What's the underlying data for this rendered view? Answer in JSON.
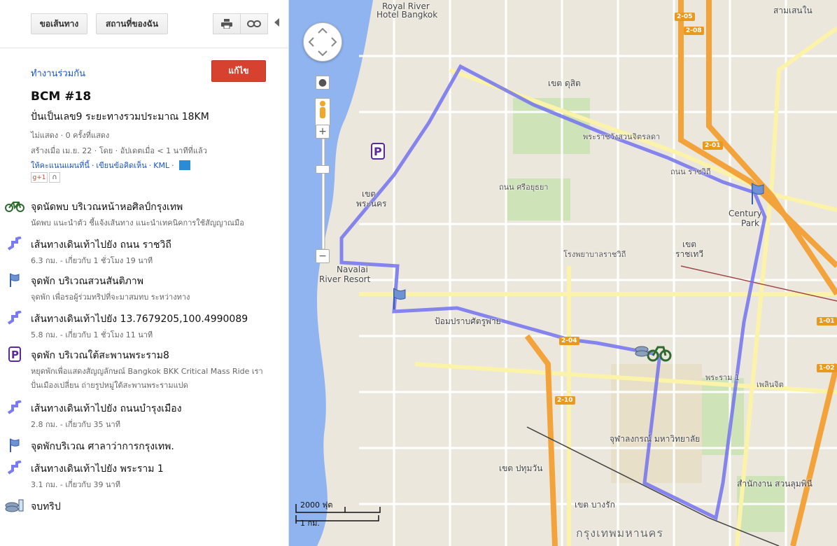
{
  "toolbar": {
    "directions": "ขอเส้นทาง",
    "my_places": "สถานที่ของฉัน"
  },
  "map_info": {
    "collaborate": "ทำงานร่วมกัน",
    "edit": "แก้ไข",
    "title": "BCM #18",
    "description": "ปั่นเป็นเลข9 ระยะทางรวมประมาณ 18KM",
    "views": "ไม่แสดง · 0 ครั้งที่แสดง",
    "created": "สร้างเมื่อ เม.ย. 22 · โดย  · อัปเดตเมื่อ < 1 นาทีที่แล้ว",
    "rate": "ให้คะแนนแผนที่นี้",
    "comment": "เขียนข้อคิดเห็น",
    "kml": "KML",
    "gplus": "g+1"
  },
  "items": [
    {
      "icon": "bicycle-icon",
      "title": "จุดนัดพบ บริเวณหน้าหอศิลป์กรุงเทพ",
      "sub": "นัดพบ แนะนำตัว ชี้แจ้งเส้นทาง แนะนำเทคนิคการใช้สัญญาณมือ",
      "sub2": ""
    },
    {
      "icon": "route-icon",
      "title": "เส้นทางเดินเท้าไปยัง ถนน ราชวิถี",
      "sub": "6.3 กม. - เกี่ยวกับ 1 ชั่วโมง 19 นาที",
      "sub2": ""
    },
    {
      "icon": "flag-icon",
      "title": "จุดพัก บริเวณสวนสันติภาพ",
      "sub": "จุดพัก เพื่อรอผู้ร่วมทริปที่จะมาสมทบ ระหว่างทาง",
      "sub2": ""
    },
    {
      "icon": "route-icon",
      "title": "เส้นทางเดินเท้าไปยัง 13.7679205,100.4990089",
      "sub": "5.8 กม. - เกี่ยวกับ 1 ชั่วโมง 11 นาที",
      "sub2": ""
    },
    {
      "icon": "parking-icon",
      "title": "จุดพัก บริเวณใต้สะพานพระราม8",
      "sub": "หยุดพักเพื่อแสดงสัญญลักษณ์ Bangkok BKK Critical Mass Ride เรา",
      "sub2": "ปั่นเมืองเปลี่ยน ถ่ายรูปหมู่ใต้สะพานพระรามแปด"
    },
    {
      "icon": "route-icon",
      "title": "เส้นทางเดินเท้าไปยัง ถนนบำรุงเมือง",
      "sub": "2.8 กม. - เกี่ยวกับ 35 นาที",
      "sub2": ""
    },
    {
      "icon": "flag-icon",
      "title": "จุดพักบริเวณ ศาลาว่าการกรุงเทพ.",
      "sub": "",
      "sub2": ""
    },
    {
      "icon": "route-icon",
      "title": "เส้นทางเดินเท้าไปยัง พระราม 1",
      "sub": "3.1 กม. - เกี่ยวกับ 39 นาที",
      "sub2": ""
    },
    {
      "icon": "finish-icon",
      "title": "จบทริป",
      "sub": "",
      "sub2": ""
    }
  ],
  "map": {
    "labels": {
      "royal_river": "Royal River",
      "hotel_bangkok": "Hotel Bangkok",
      "samsen_nai": "สามเสนใน",
      "khet_dusit": "เขต ดุสิต",
      "phra_nakhon_1": "เขต",
      "phra_nakhon_2": "พระนคร",
      "ratchathewi_1": "เขต",
      "ratchathewi_2": "ราชเทวี",
      "century_park_1": "Century",
      "century_park_2": "Park",
      "navalai_1": "Navalai",
      "navalai_2": "River Resort",
      "pom_prap": "ป้อมปราบศัตรูพ่าย",
      "pathumwan": "เขต ปทุมวัน",
      "bang_rak": "เขต บางรัก",
      "krungthep": "กรุงเทพมหานคร",
      "chula": "จุฬาลงกรณ์ มหาวิทยาลัย",
      "lumpini": "สำนักงาน สวนลุมพินี",
      "ratchawithi_rd": "ถนน ราชวิถี",
      "si_ayutthaya": "ถนน ศรีอยุธยา",
      "rama1": "พระราม 1",
      "phloen_chit": "เพลินจิต",
      "rajavithi_hosp": "โรงพยาบาลราชวิถี",
      "chitralada": "พระราชวังสวนจิตรลดา"
    },
    "shields": [
      "2-05",
      "2-08",
      "2-01",
      "2-04",
      "2-10",
      "1-01",
      "1-02"
    ],
    "scale_ft": "2000 ฟุต",
    "scale_km": "1 กม."
  }
}
